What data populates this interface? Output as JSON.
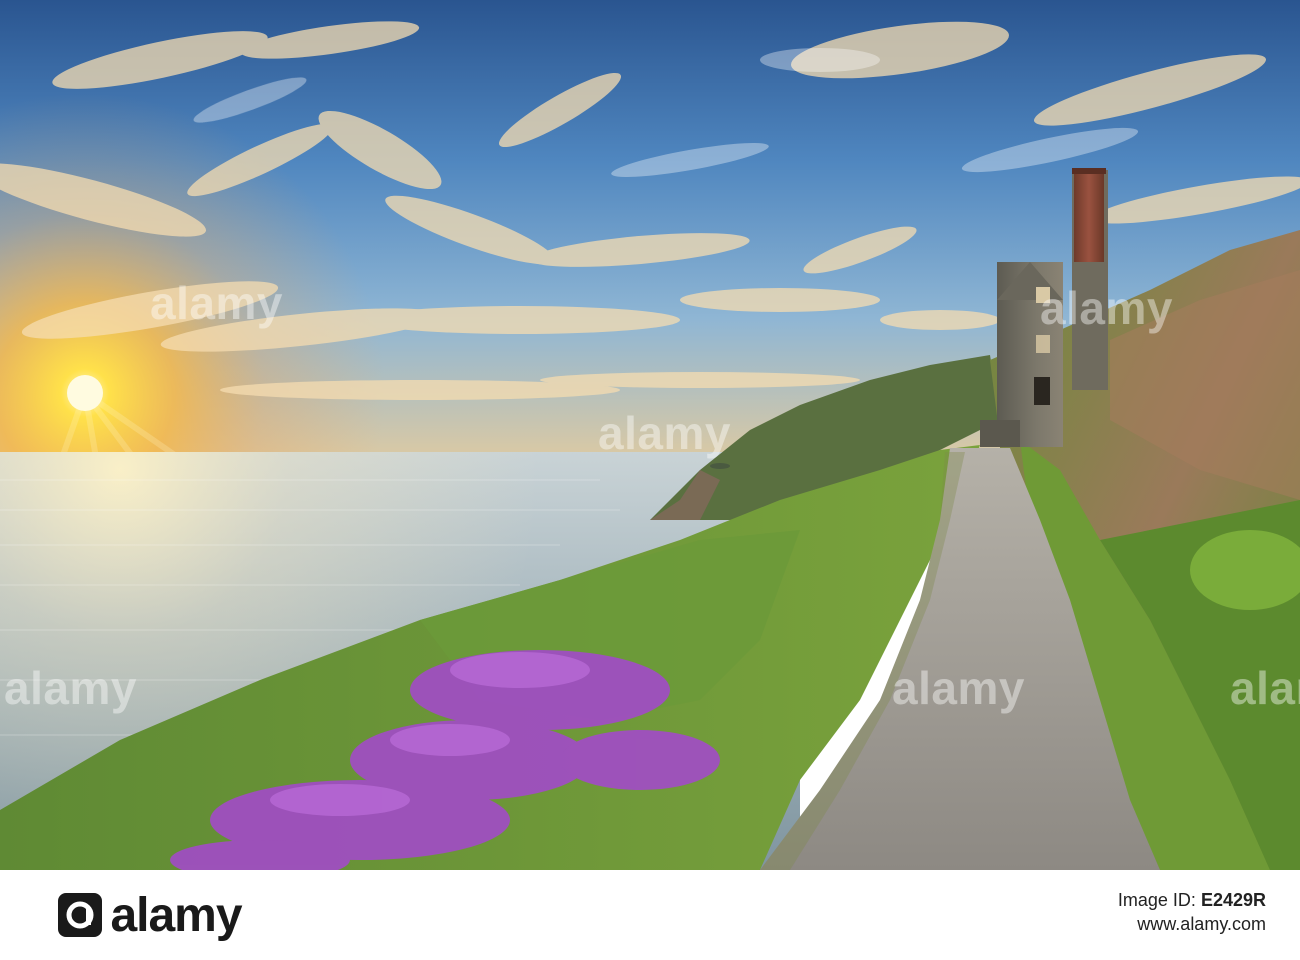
{
  "photo": {
    "subject": "Coastal path at sunset",
    "colors": {
      "sky_top": "#2e5f9a",
      "sky_mid": "#6fa3cf",
      "sun_glow": "#ffd23a",
      "sea": "#cfd7d8",
      "grass": "#5f8e33",
      "heather": "#a345c6",
      "path": "#9a9690",
      "chimney": "#8a4a35",
      "engine_house": "#6d6a5e"
    }
  },
  "watermarks": [
    {
      "text": "alamy"
    },
    {
      "text": "alamy"
    },
    {
      "text": "alamy"
    },
    {
      "text": "alamy"
    },
    {
      "text": "alamy"
    },
    {
      "text": "alamy"
    }
  ],
  "footer": {
    "brand": "alamy",
    "image_id_label": "Image ID:",
    "image_id": "E2429R",
    "url": "www.alamy.com"
  }
}
